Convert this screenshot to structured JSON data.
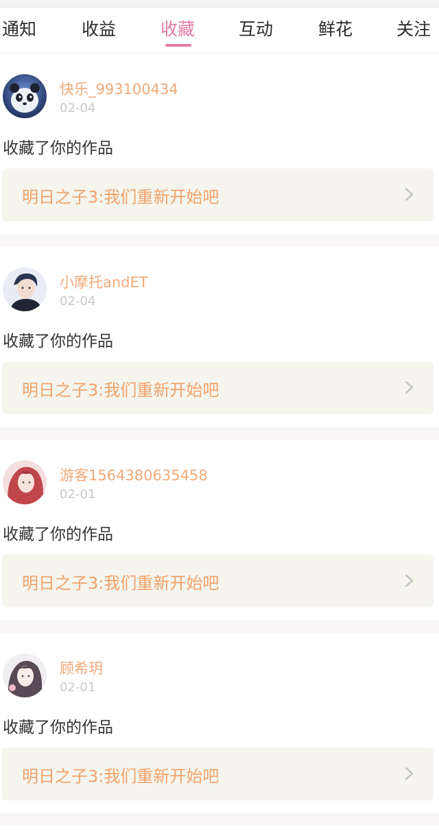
{
  "tabs": [
    {
      "label": "通知",
      "active": false
    },
    {
      "label": "收益",
      "active": false
    },
    {
      "label": "收藏",
      "active": true
    },
    {
      "label": "互动",
      "active": false
    },
    {
      "label": "鲜花",
      "active": false
    },
    {
      "label": "关注",
      "active": false
    }
  ],
  "colors": {
    "accent": "#e87ba7",
    "username": "#f0a978",
    "work_title": "#f0a26b",
    "date": "#c8c8c8"
  },
  "items": [
    {
      "username": "快乐_993100434",
      "date": "02-04",
      "action": "收藏了你的作品",
      "work_title": "明日之子3:我们重新开始吧",
      "avatar": "panda-avatar"
    },
    {
      "username": "小摩托andET",
      "date": "02-04",
      "action": "收藏了你的作品",
      "work_title": "明日之子3:我们重新开始吧",
      "avatar": "boy-portrait-avatar"
    },
    {
      "username": "游客1564380635458",
      "date": "02-01",
      "action": "收藏了你的作品",
      "work_title": "明日之子3:我们重新开始吧",
      "avatar": "red-hair-girl-avatar"
    },
    {
      "username": "顾希玥",
      "date": "02-01",
      "action": "收藏了你的作品",
      "work_title": "明日之子3:我们重新开始吧",
      "avatar": "girl-portrait-avatar"
    }
  ]
}
